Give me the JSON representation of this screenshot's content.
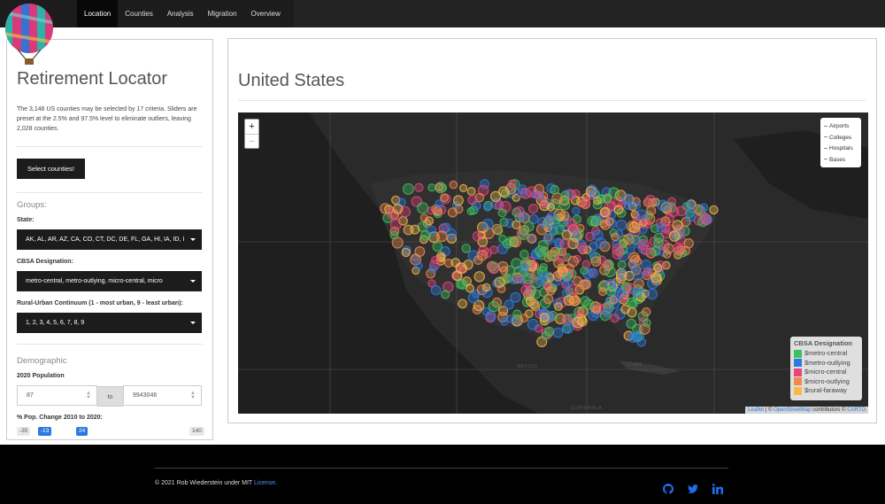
{
  "navbar": {
    "items": [
      "Location",
      "Counties",
      "Analysis",
      "Migration",
      "Overview"
    ],
    "active": "Location"
  },
  "sidebar": {
    "title": "Retirement Locator",
    "description": "The 3,146 US counties may be selected by 17 criteria. Sliders are preset at the 2.5% and 97.5% level to eliminate outliers, leaving 2,028 counties.",
    "select_button": "Select counties!",
    "groups_heading": "Groups:",
    "state_label": "State:",
    "state_value": "AK, AL, AR, AZ, CA, CO, CT, DC, DE, FL, GA, HI, IA, ID, I",
    "cbsa_label": "CBSA Designation:",
    "cbsa_value": "metro-central, metro-outlying, micro-central, micro",
    "rural_label": "Rural-Urban Continuum (1 - most urban, 9 - least urban):",
    "rural_value": "1, 2, 3, 4, 5, 6, 7, 8, 9",
    "demographic_heading": "Demographic",
    "pop_label": "2020 Population",
    "pop_min": "87",
    "pop_to": "to",
    "pop_max": "9943046",
    "popchange_label": "% Pop. Change 2010 to 2020:",
    "slider": {
      "min": "-35",
      "low": "-13",
      "high": "24",
      "max": "140"
    }
  },
  "main": {
    "title": "United States",
    "map": {
      "zoom_in": "+",
      "zoom_out": "−",
      "layers": [
        "Airports",
        "Colleges",
        "Hospitals",
        "Bases"
      ],
      "legend_title": "CBSA Designation",
      "legend": [
        {
          "label": "$metro-central",
          "color": "#3fbf5f"
        },
        {
          "label": "$metro-outlying",
          "color": "#2a7ae2"
        },
        {
          "label": "$micro-central",
          "color": "#e8457a"
        },
        {
          "label": "$micro-outlying",
          "color": "#f08a4b"
        },
        {
          "label": "$rural-faraway",
          "color": "#f5b84a"
        }
      ],
      "labels": {
        "mexico": "MÉXICO",
        "cuba": "CUBA",
        "guatemala": "GUATEMALA"
      },
      "attrib_leaflet": "Leaflet",
      "attrib_sep": " | © ",
      "attrib_osm": "OpenStreetMap",
      "attrib_mid": " contributors © ",
      "attrib_carto": "CARTO"
    }
  },
  "footer": {
    "text": "© 2021 Rob Wiederstein under MIT ",
    "license": "License",
    "period": ".",
    "icons": [
      "github-icon",
      "twitter-icon",
      "linkedin-icon"
    ]
  }
}
